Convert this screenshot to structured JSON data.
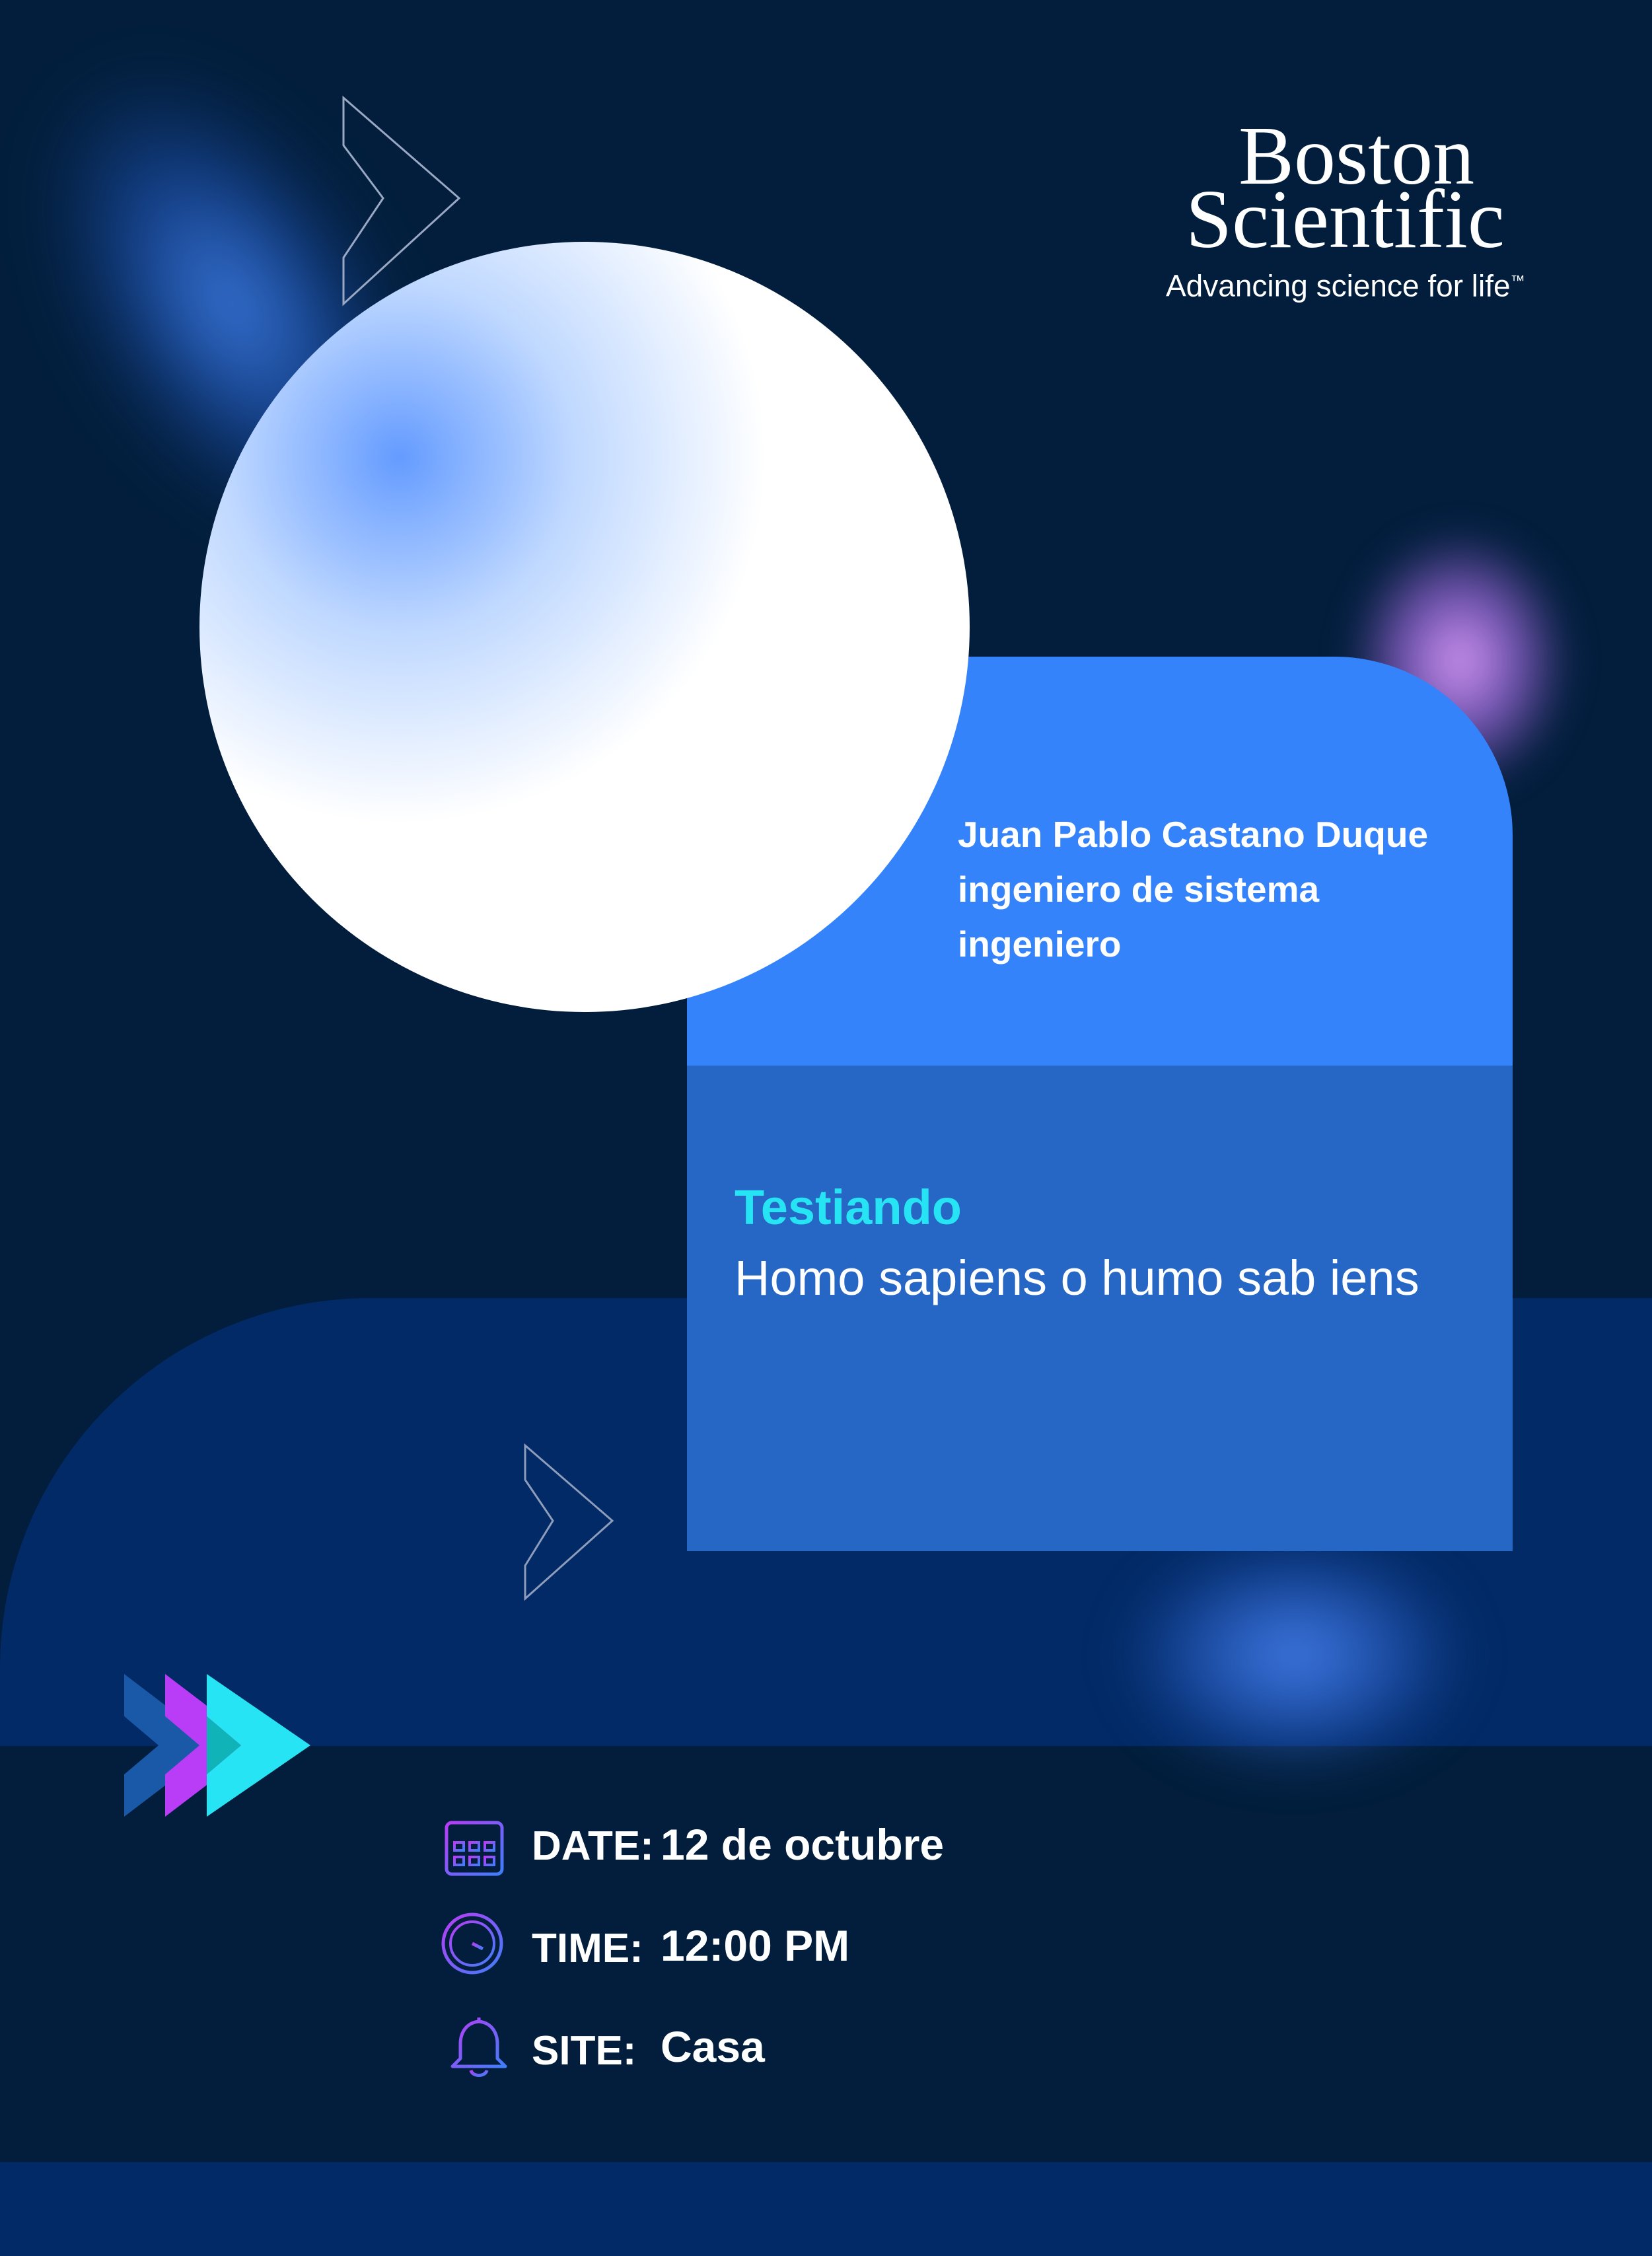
{
  "brand": {
    "line1": "Boston",
    "line2": "Scientific",
    "tagline": "Advancing science for life",
    "trademark": "™"
  },
  "speaker": {
    "name": "Juan Pablo Castano Duque",
    "role": "ingeniero de sistema",
    "title": "ingeniero"
  },
  "topic": {
    "title": "Testiando",
    "description": "Homo sapiens o humo sab iens"
  },
  "details": {
    "date_label": "DATE:",
    "date_value": "12 de octubre",
    "time_label": "TIME:",
    "time_value": "12:00 PM",
    "site_label": "SITE:",
    "site_value": "Casa"
  },
  "icons": {
    "date": "calendar-icon",
    "time": "clock-icon",
    "site": "bell-icon"
  },
  "colors": {
    "background": "#021e3c",
    "band": "#022a66",
    "card_top": "#3583fb",
    "card_bottom": "#2666c4",
    "accent_cyan": "#27e4f5",
    "accent_purple": "#b93cf6",
    "accent_dark_blue": "#1a58a8"
  }
}
